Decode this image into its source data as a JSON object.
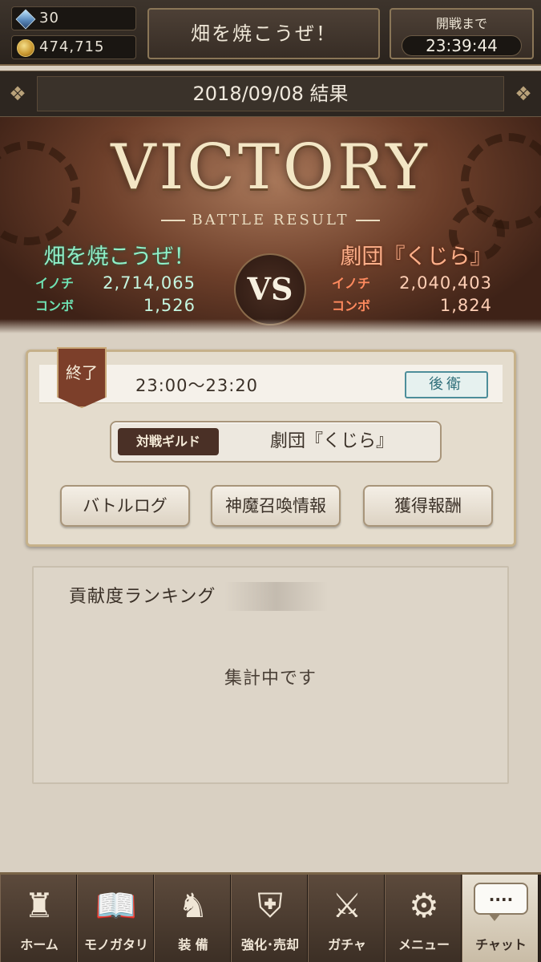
{
  "resources": {
    "stones": "30",
    "coins": "474,715"
  },
  "guild_banner": "畑を焼こうぜ！",
  "countdown": {
    "label": "開戦まで",
    "time": "23:39:44"
  },
  "date_header": "2018/09/08 結果",
  "victory": {
    "title": "VICTORY",
    "subtitle": "BATTLE RESULT",
    "vs": "VS",
    "mine": {
      "name": "畑を焼こうぜ！",
      "life_label": "イノチ",
      "life": "2,714,065",
      "combo_label": "コンボ",
      "combo": "1,526"
    },
    "opponent": {
      "name": "劇団『くじら』",
      "life_label": "イノチ",
      "life": "2,040,403",
      "combo_label": "コンボ",
      "combo": "1,824"
    }
  },
  "result_card": {
    "status": "終了",
    "time_range": "23:00〜23:20",
    "position": "後衛",
    "opponent_label": "対戦ギルド",
    "opponent_name": "劇団『くじら』",
    "buttons": [
      "バトルログ",
      "神魔召喚情報",
      "獲得報酬"
    ]
  },
  "ranking": {
    "title": "貢献度ランキング",
    "status": "集計中です"
  },
  "nav": [
    {
      "label": "ホーム",
      "icon": "castle-icon"
    },
    {
      "label": "モノガタリ",
      "icon": "book-icon"
    },
    {
      "label": "装 備",
      "icon": "puppet-icon"
    },
    {
      "label": "強化･売却",
      "icon": "helmet-icon"
    },
    {
      "label": "ガチャ",
      "icon": "swords-icon"
    },
    {
      "label": "メニュー",
      "icon": "gears-icon"
    },
    {
      "label": "チャット",
      "icon": "chat-icon",
      "bubble": "...."
    }
  ]
}
